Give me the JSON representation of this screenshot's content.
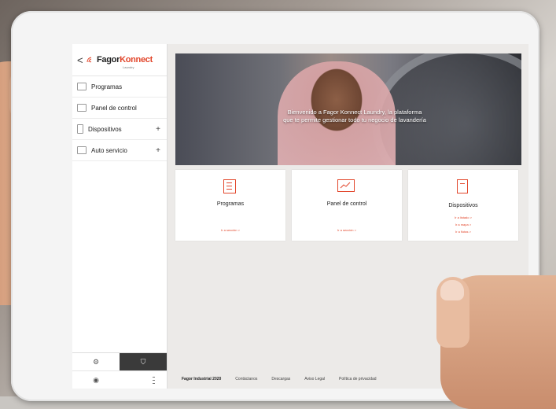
{
  "brand": {
    "back_glyph": "<",
    "name_part1": "Fagor",
    "name_part2": "Konnect",
    "sub": "Laundry"
  },
  "sidebar": {
    "items": [
      {
        "label": "Programas",
        "icon": "programs-icon",
        "expandable": false
      },
      {
        "label": "Panel de control",
        "icon": "dashboard-icon",
        "expandable": false
      },
      {
        "label": "Dispositivos",
        "icon": "device-icon",
        "expandable": true
      },
      {
        "label": "Auto servicio",
        "icon": "self-service-icon",
        "expandable": true
      }
    ],
    "plus_glyph": "+",
    "bottom": {
      "settings_icon": "gear-icon",
      "account_icon": "shield-icon",
      "user_icon": "user-icon"
    }
  },
  "hero": {
    "line1": "Bienvenido a Fagor Konnect Laundry, la plataforma",
    "line2": "que te permite gestionar todo tu negocio de lavandería"
  },
  "cards": [
    {
      "title": "Programas",
      "icon": "list-icon",
      "links": [
        "Ir a sección >"
      ]
    },
    {
      "title": "Panel de control",
      "icon": "chart-icon",
      "links": [
        "Ir a sección >"
      ]
    },
    {
      "title": "Dispositivos",
      "icon": "device-icon",
      "links": [
        "Ir a listado >",
        "Ir a mapa >",
        "Ir a flotas >"
      ]
    }
  ],
  "footer": {
    "company": "Fagor Industrial 2020",
    "links": [
      "Contáctanos",
      "Descargas",
      "Aviso Legal",
      "Política de privacidad"
    ]
  },
  "colors": {
    "accent": "#e2462b",
    "sidebar_dark": "#3a3a3a"
  }
}
